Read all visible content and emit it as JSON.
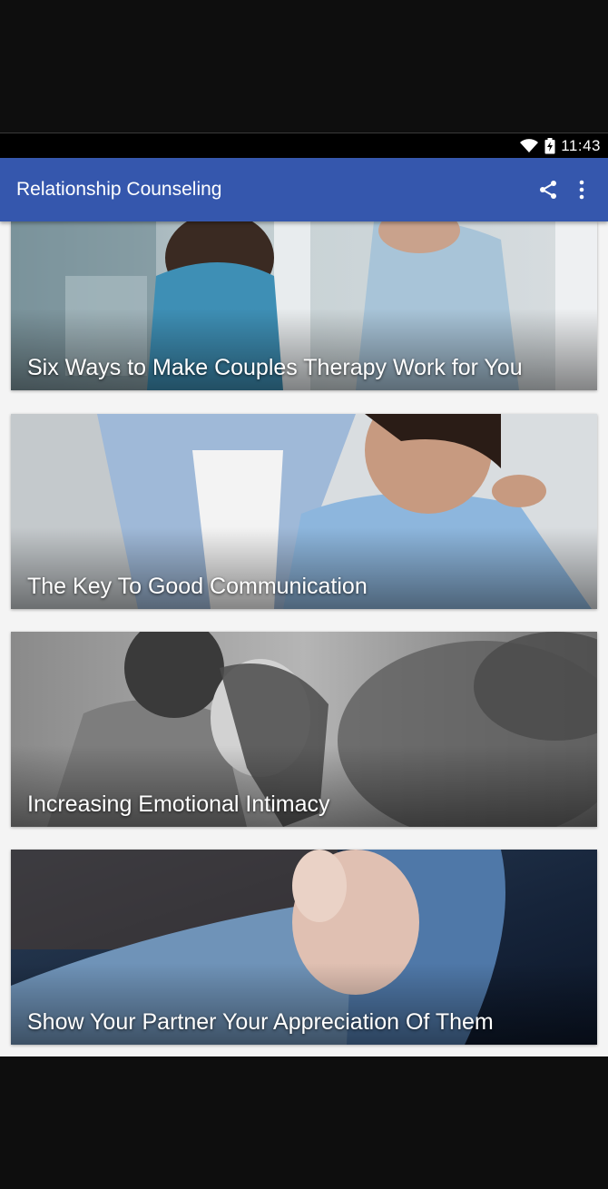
{
  "status_bar": {
    "time": "11:43",
    "icons": [
      "wifi-icon",
      "battery-icon"
    ]
  },
  "app_bar": {
    "title": "Relationship Counseling",
    "actions": [
      "share-icon",
      "overflow-menu-icon"
    ],
    "color": "#3557ad"
  },
  "articles": [
    {
      "title": "Six Ways to Make Couples Therapy Work for You"
    },
    {
      "title": "The Key To Good Communication"
    },
    {
      "title": "Increasing Emotional Intimacy"
    },
    {
      "title": "Show Your Partner Your Appreciation Of Them"
    }
  ]
}
